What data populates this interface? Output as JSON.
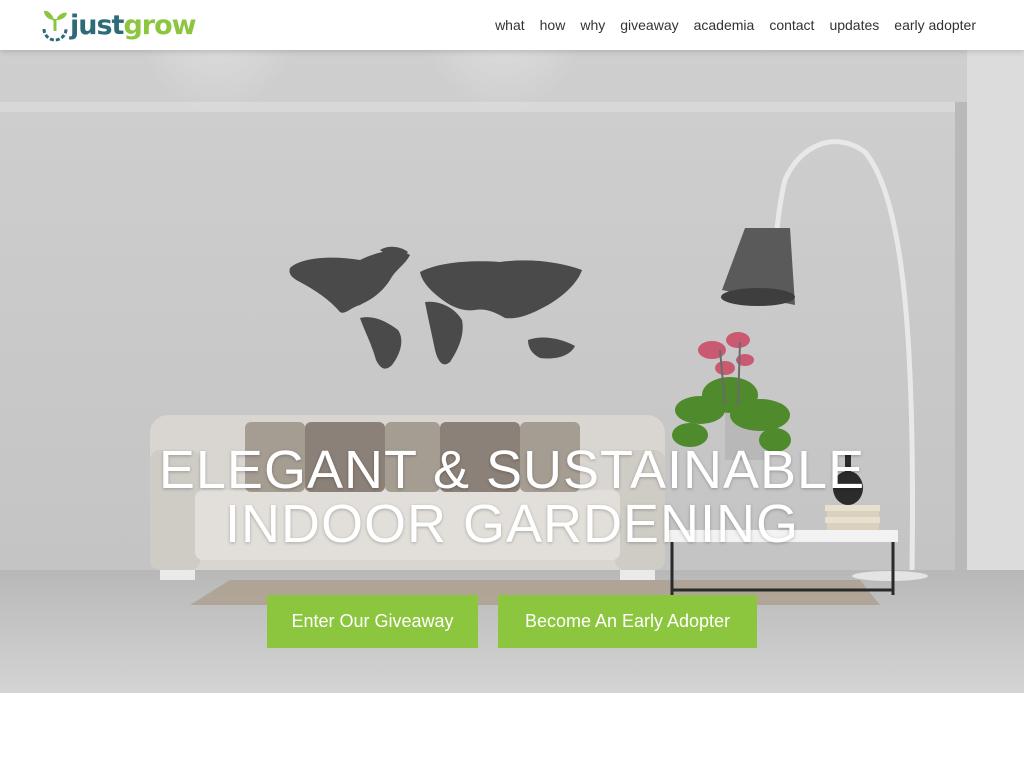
{
  "brand": {
    "name_part1": "just",
    "name_part2": "grow",
    "color_primary": "#2d6b78",
    "color_accent": "#8cc63f"
  },
  "nav": {
    "items": [
      "what",
      "how",
      "why",
      "giveaway",
      "academia",
      "contact",
      "updates",
      "early adopter"
    ]
  },
  "hero": {
    "headline_line1": "ELEGANT & SUSTAINABLE",
    "headline_line2": "INDOOR GARDENING",
    "primary_cta": "Enter Our Giveaway",
    "secondary_cta": "Become An Early Adopter"
  },
  "icons": {
    "logo": "sprout-logo-icon"
  }
}
